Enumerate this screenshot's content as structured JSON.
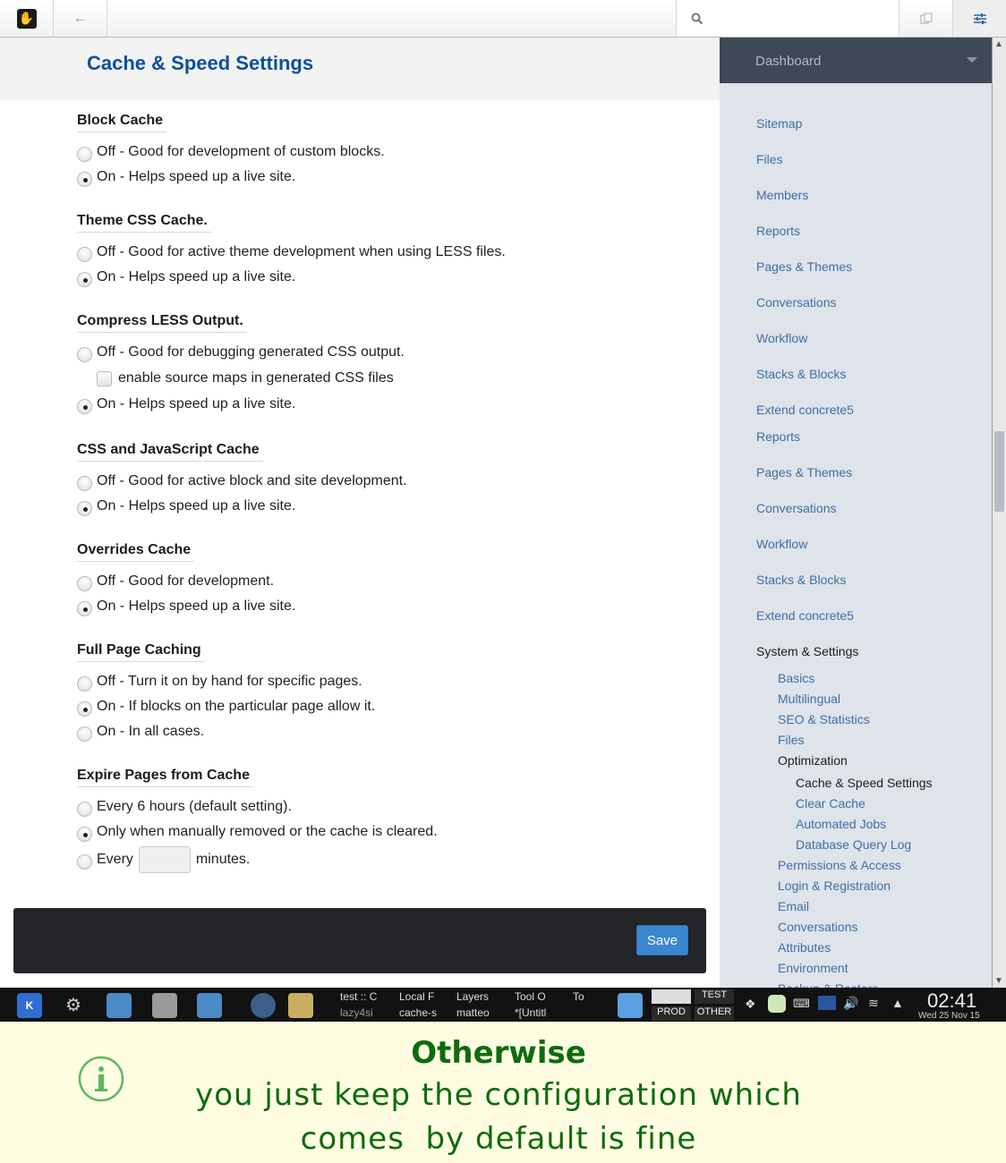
{
  "toolbar": {
    "logo_icon": "concrete5-hand-icon",
    "back_icon": "arrow-left-icon",
    "search_icon": "search-icon",
    "search_placeholder": "",
    "intelligent_icon": "copy-pages-icon",
    "panel_icon": "sliders-icon"
  },
  "page": {
    "title": "Cache & Speed Settings"
  },
  "sections": [
    {
      "title": "Block Cache",
      "options": [
        {
          "label": "Off - Good for development of custom blocks.",
          "checked": false
        },
        {
          "label": "On - Helps speed up a live site.",
          "checked": true
        }
      ]
    },
    {
      "title": "Theme CSS Cache.",
      "options": [
        {
          "label": "Off - Good for active theme development when using LESS files.",
          "checked": false
        },
        {
          "label": "On - Helps speed up a live site.",
          "checked": true
        }
      ]
    },
    {
      "title": "Compress LESS Output.",
      "options": [
        {
          "label": "Off - Good for debugging generated CSS output.",
          "checked": false
        },
        {
          "label": "On - Helps speed up a live site.",
          "checked": true
        }
      ],
      "checkbox": {
        "label": "enable source maps in generated CSS files",
        "checked": false
      }
    },
    {
      "title": "CSS and JavaScript Cache",
      "options": [
        {
          "label": "Off - Good for active block and site development.",
          "checked": false
        },
        {
          "label": "On - Helps speed up a live site.",
          "checked": true
        }
      ]
    },
    {
      "title": "Overrides Cache",
      "options": [
        {
          "label": "Off - Good for development.",
          "checked": false
        },
        {
          "label": "On - Helps speed up a live site.",
          "checked": true
        }
      ]
    },
    {
      "title": "Full Page Caching",
      "options": [
        {
          "label": "Off - Turn it on by hand for specific pages.",
          "checked": false
        },
        {
          "label": "On - If blocks on the particular page allow it.",
          "checked": true
        },
        {
          "label": "On - In all cases.",
          "checked": false
        }
      ]
    },
    {
      "title": "Expire Pages from Cache",
      "options": [
        {
          "label": "Every 6 hours (default setting).",
          "checked": false
        },
        {
          "label": "Only when manually removed or the cache is cleared.",
          "checked": true
        },
        {
          "label_before": "Every",
          "label_after": "minutes.",
          "value": "",
          "checked": false
        }
      ]
    }
  ],
  "footer": {
    "save_label": "Save"
  },
  "sidebar": {
    "dashboard_label": "Dashboard",
    "items": [
      "Sitemap",
      "Files",
      "Members",
      "Reports",
      "Pages & Themes",
      "Conversations",
      "Workflow",
      "Stacks & Blocks",
      "Extend concrete5",
      "Reports",
      "Pages & Themes",
      "Conversations",
      "Workflow",
      "Stacks & Blocks",
      "Extend concrete5"
    ],
    "system_label": "System & Settings",
    "system_items": [
      "Basics",
      "Multilingual",
      "SEO & Statistics",
      "Files"
    ],
    "optimization_label": "Optimization",
    "optimization_items": [
      "Cache & Speed Settings",
      "Clear Cache",
      "Automated Jobs",
      "Database Query Log"
    ],
    "system_items_after": [
      "Permissions & Access",
      "Login & Registration",
      "Email",
      "Conversations",
      "Attributes",
      "Environment",
      "Backup & Restore"
    ]
  },
  "taskbar": {
    "tasks_row1": [
      "test :: C",
      "Local F",
      "Layers",
      "Tool O",
      "To"
    ],
    "tasks_row2": [
      "lazy4si",
      "cache-s",
      "matteo",
      "*[Untitl"
    ],
    "activities": [
      "TEST",
      "PROD",
      "OTHER"
    ],
    "time": "02:41",
    "date": "Wed 25 Nov 15"
  },
  "banner": {
    "icon": "info-icon",
    "title": "Otherwise",
    "line1": "you just keep the configuration which",
    "line2": "comes  by default is fine"
  },
  "colors": {
    "accent": "#0d4f9c",
    "save": "#3a87d0",
    "banner_text": "#0e6b0e",
    "banner_bg": "#fefde2"
  }
}
